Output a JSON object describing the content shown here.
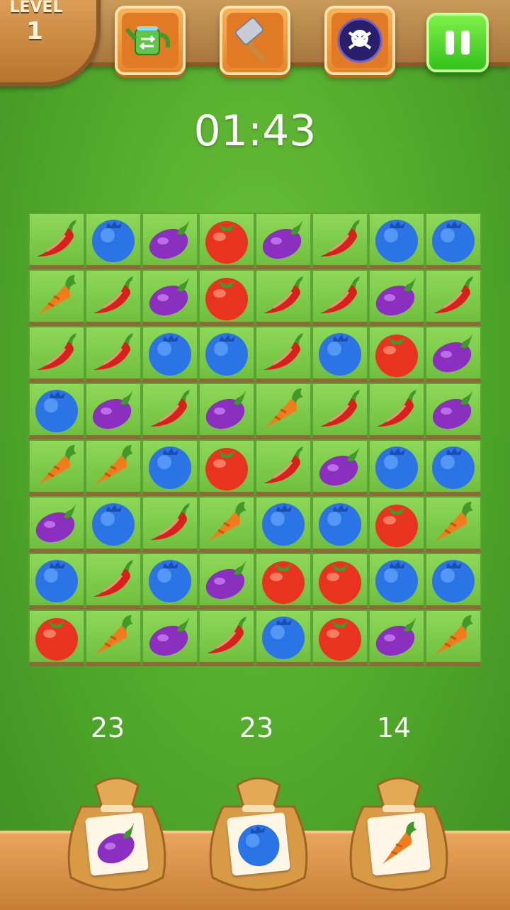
{
  "hud": {
    "level_label": "LEVEL",
    "level_number": "1",
    "timer": "01:43",
    "boosters": [
      {
        "name": "watering-can-icon"
      },
      {
        "name": "hammer-icon"
      },
      {
        "name": "skull-bomb-icon"
      }
    ],
    "pause_icon": "pause-icon"
  },
  "board": {
    "rows": [
      [
        "pepper",
        "blueberry",
        "eggplant",
        "tomato",
        "eggplant",
        "pepper",
        "blueberry",
        "blueberry"
      ],
      [
        "carrot",
        "pepper",
        "eggplant",
        "tomato",
        "pepper",
        "pepper",
        "eggplant",
        "pepper"
      ],
      [
        "pepper",
        "pepper",
        "blueberry",
        "blueberry",
        "pepper",
        "blueberry",
        "tomato",
        "eggplant"
      ],
      [
        "blueberry",
        "eggplant",
        "pepper",
        "eggplant",
        "carrot",
        "pepper",
        "pepper",
        "eggplant"
      ],
      [
        "carrot",
        "carrot",
        "blueberry",
        "tomato",
        "pepper",
        "eggplant",
        "blueberry",
        "blueberry"
      ],
      [
        "eggplant",
        "blueberry",
        "pepper",
        "carrot",
        "blueberry",
        "blueberry",
        "tomato",
        "carrot"
      ],
      [
        "blueberry",
        "pepper",
        "blueberry",
        "eggplant",
        "tomato",
        "tomato",
        "blueberry",
        "blueberry"
      ],
      [
        "tomato",
        "carrot",
        "eggplant",
        "pepper",
        "blueberry",
        "tomato",
        "eggplant",
        "carrot"
      ]
    ]
  },
  "goals": [
    {
      "item": "eggplant",
      "count": "23"
    },
    {
      "item": "blueberry",
      "count": "23"
    },
    {
      "item": "carrot",
      "count": "14"
    }
  ],
  "colors": {
    "pepper": "#d8201c",
    "blueberry": "#2a74e6",
    "eggplant": "#8a2fc0",
    "tomato": "#e8341e",
    "carrot": "#f07d1c"
  }
}
